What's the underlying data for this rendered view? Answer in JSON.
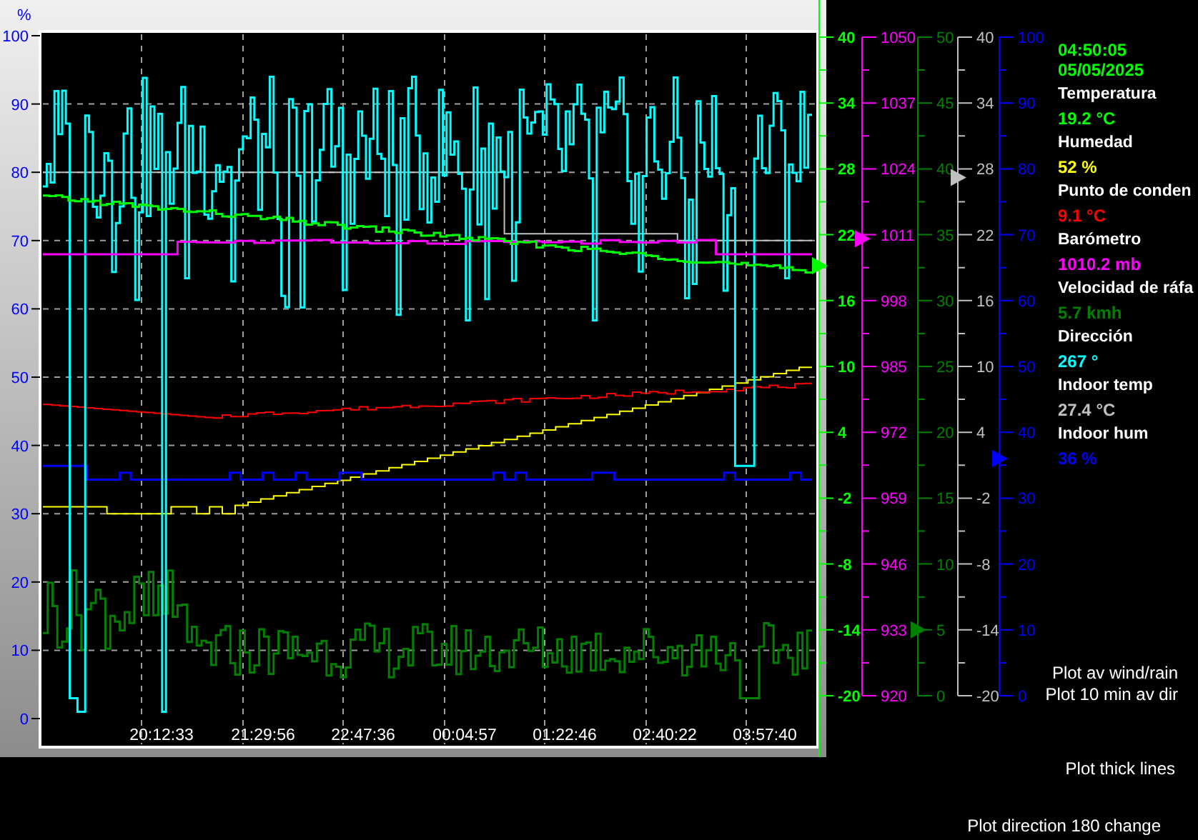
{
  "left_axis": {
    "unit": "%",
    "ticks": [
      "100",
      "90",
      "80",
      "70",
      "60",
      "50",
      "40",
      "30",
      "20",
      "10",
      "0"
    ]
  },
  "time_axis": {
    "ticks": [
      "20:12:33",
      "21:29:56",
      "22:47:36",
      "00:04:57",
      "01:22:46",
      "02:40:22",
      "03:57:40"
    ]
  },
  "right_axes": [
    {
      "color": "#00ff00",
      "ticks": [
        "40",
        "34",
        "28",
        "22",
        "16",
        "10",
        "4",
        "-2",
        "-8",
        "-14",
        "-20"
      ],
      "marker": {
        "level": 0.653
      }
    },
    {
      "color": "#ff00ff",
      "ticks": [
        "1050",
        "1037",
        "1024",
        "1011",
        "998",
        "985",
        "972",
        "959",
        "946",
        "933",
        "920"
      ],
      "marker": {
        "level": 0.694
      }
    },
    {
      "color": "#008000",
      "ticks": [
        "50",
        "45",
        "40",
        "35",
        "30",
        "25",
        "20",
        "15",
        "10",
        "5",
        "0"
      ],
      "marker": {
        "level": 0.1
      }
    },
    {
      "color": "#c0c0c0",
      "ticks": [
        "40",
        "34",
        "28",
        "22",
        "16",
        "10",
        "4",
        "-2",
        "-8",
        "-14",
        "-20"
      ],
      "marker": {
        "level": 0.787
      }
    },
    {
      "color": "#0000ff",
      "ticks": [
        "100",
        "90",
        "80",
        "70",
        "60",
        "50",
        "40",
        "30",
        "20",
        "10",
        "0"
      ],
      "marker": {
        "level": 0.36
      }
    }
  ],
  "legend": {
    "time": "04:50:05",
    "date": "05/05/2025",
    "readings": [
      {
        "label": "Temperatura",
        "value": "19.2 °C",
        "color": "#00ff00"
      },
      {
        "label": "Humedad",
        "value": "52 %",
        "color": "#ffff00"
      },
      {
        "label": "Punto de conden",
        "value": "9.1 °C",
        "color": "#ff0000"
      },
      {
        "label": "Barómetro",
        "value": "1010.2 mb",
        "color": "#ff00ff"
      },
      {
        "label": "Velocidad de ráfa",
        "value": "5.7 kmh",
        "color": "#008000"
      },
      {
        "label": "Dirección",
        "value": "267 °",
        "color": "#00ffff"
      },
      {
        "label": "Indoor temp",
        "value": "27.4 °C",
        "color": "#c0c0c0"
      },
      {
        "label": "Indoor hum",
        "value": "36 %",
        "color": "#0000ff"
      }
    ]
  },
  "options": [
    "Plot av wind/rain",
    "Plot 10 min av dir",
    "Plot thick lines",
    "Plot direction 180 change"
  ]
}
